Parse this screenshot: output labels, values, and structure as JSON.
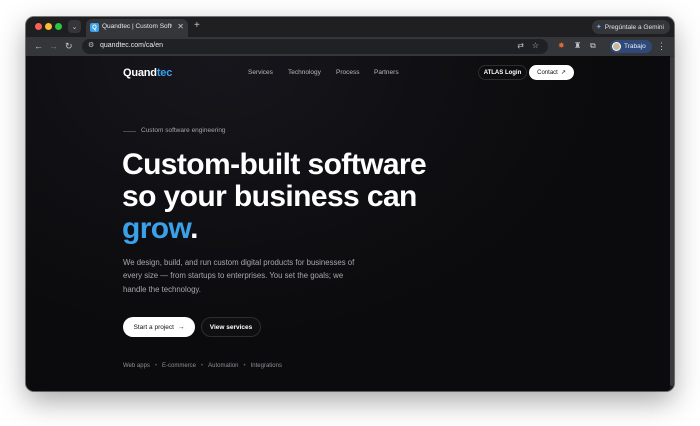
{
  "browser": {
    "tab_title": "Quandtec | Custom Software",
    "favicon_letter": "Q",
    "close_glyph": "✕",
    "new_tab_glyph": "+",
    "tab_list_glyph": "⌄",
    "gemini_label": "Pregúntale a Gemini",
    "url": "quandtec.com/ca/en",
    "profile_label": "Trabajo",
    "icons": [
      "back-icon",
      "forward-icon",
      "reload-icon",
      "site-info-icon",
      "translate-icon",
      "star-icon",
      "extension-icon",
      "puzzle-icon",
      "menu-icon"
    ]
  },
  "site": {
    "logo_part1": "Quand",
    "logo_part2": "tec",
    "nav": [
      "Services",
      "Technology",
      "Process",
      "Partners"
    ],
    "atlas_login": "ATLAS Login",
    "contact": "Contact",
    "contact_arrow": "↗",
    "eyebrow": "Custom software engineering",
    "hero_line1": "Custom-built software",
    "hero_line2": "so your business can",
    "hero_accent": "grow",
    "hero_period": ".",
    "description": "We design, build, and run custom digital products for businesses of every size — from startups to enterprises. You set the goals; we handle the technology.",
    "cta_primary": "Start a project",
    "cta_primary_arrow": "→",
    "cta_secondary": "View services",
    "tags": [
      "Web apps",
      "E-commerce",
      "Automation",
      "Integrations"
    ],
    "tag_separator": "•"
  },
  "colors": {
    "accent": "#3aa0ea",
    "background": "#0d0d0f",
    "text": "#ffffff",
    "muted": "#a7a7ad"
  }
}
